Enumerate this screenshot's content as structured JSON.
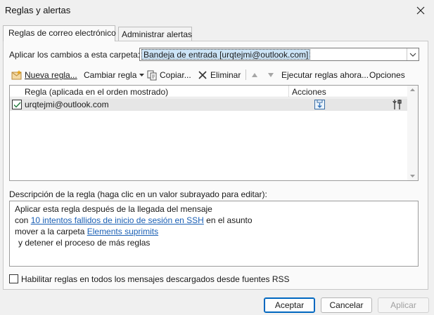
{
  "window": {
    "title": "Reglas y alertas",
    "close_icon": "close-icon"
  },
  "tabs": [
    {
      "label": "Reglas de correo electrónico",
      "active": true
    },
    {
      "label": "Administrar alertas",
      "active": false
    }
  ],
  "folder": {
    "label": "Aplicar los cambios a esta carpeta:",
    "value": "Bandeja de entrada [urqtejmi@outlook.com]"
  },
  "toolbar": {
    "new_rule": "Nueva regla...",
    "change_rule": "Cambiar regla",
    "copy": "Copiar...",
    "delete": "Eliminar",
    "run_rules": "Ejecutar reglas ahora...",
    "options": "Opciones"
  },
  "rules_list": {
    "col_rule": "Regla (aplicada en el orden mostrado)",
    "col_actions": "Acciones",
    "rows": [
      {
        "name": "urqtejmi@outlook.com",
        "checked": true
      }
    ]
  },
  "description": {
    "label": "Descripción de la regla (haga clic en un valor subrayado para editar):",
    "line1": "Aplicar esta regla después de la llegada del mensaje",
    "line2_prefix": "con ",
    "line2_link": "10 intentos fallidos de inicio de sesión en SSH",
    "line2_suffix": " en el asunto",
    "line3_prefix": "mover a la carpeta ",
    "line3_link": "Elements suprimits",
    "line4": "y detener el proceso de más reglas"
  },
  "rss": {
    "label": "Habilitar reglas en todos los mensajes descargados desde fuentes RSS",
    "checked": false
  },
  "buttons": {
    "accept": "Aceptar",
    "cancel": "Cancelar",
    "apply": "Aplicar"
  }
}
